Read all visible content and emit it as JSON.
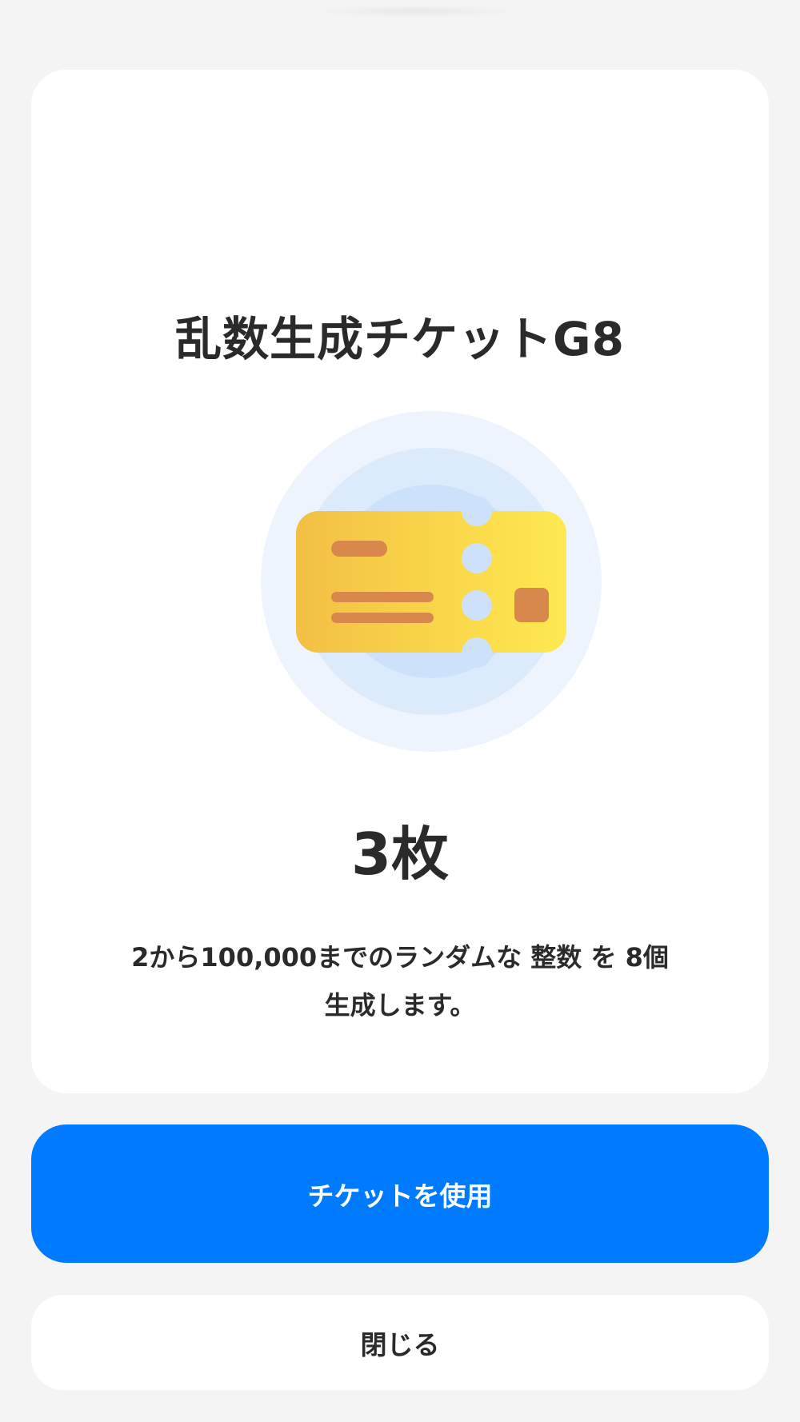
{
  "dialog": {
    "title": "乱数生成チケットG8",
    "count": "3枚",
    "description_line1": "2から100,000までのランダムな 整数 を 8個",
    "description_line2": "生成します。",
    "icon": "ticket-icon"
  },
  "actions": {
    "use_label": "チケットを使用",
    "close_label": "閉じる"
  },
  "colors": {
    "primary": "#007aff",
    "ticket_yellow": "#f6c940",
    "ticket_accent": "#d8884c",
    "halo_blue": "#dbeafc",
    "background": "#f4f4f5"
  }
}
